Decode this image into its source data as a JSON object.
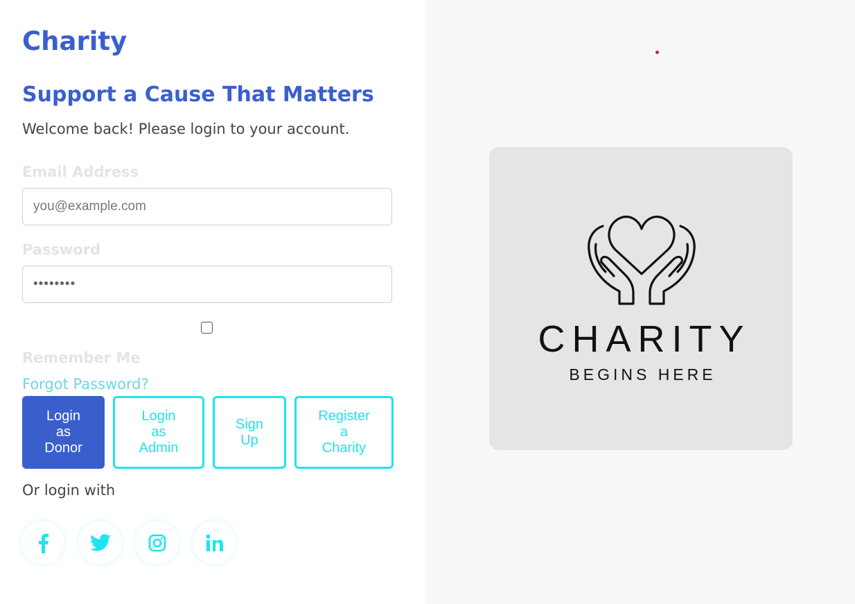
{
  "brand": {
    "name": "Charity"
  },
  "hero": {
    "headline": "Support a Cause That Matters",
    "welcome": "Welcome back! Please login to your account."
  },
  "form": {
    "email_label": "Email Address",
    "email_placeholder": "you@example.com",
    "password_label": "Password",
    "password_value": "••••••••",
    "remember_label": "Remember Me",
    "remember_checked": false,
    "forgot_link": "Forgot Password?"
  },
  "buttons": [
    {
      "label": "Login\nas\nDonor",
      "style": "primary"
    },
    {
      "label": "Login\nas\nAdmin",
      "style": "outline"
    },
    {
      "label": "Sign\nUp",
      "style": "outline"
    },
    {
      "label": "Register\na\nCharity",
      "style": "outline"
    }
  ],
  "social": {
    "prompt": "Or login with",
    "icons": [
      "facebook-icon",
      "twitter-icon",
      "instagram-icon",
      "linkedin-icon"
    ]
  },
  "logo": {
    "title": "CHARITY",
    "subtitle": "BEGINS HERE"
  },
  "colors": {
    "brand_blue": "#3a5fcd",
    "accent_cyan": "#1de4f0",
    "link_cyan": "#6fd6e3",
    "panel_bg": "#f8f8f8",
    "logo_card_bg": "#e5e5e5"
  }
}
